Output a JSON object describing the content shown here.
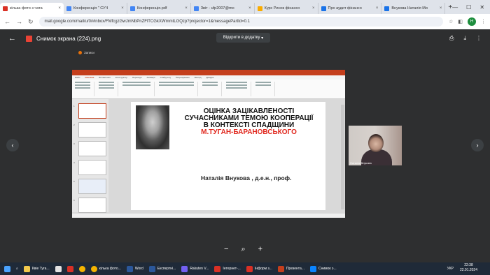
{
  "tabs": [
    {
      "title": "кілька фото з чата",
      "color": "#d93025",
      "active": true
    },
    {
      "title": "Конференція \" СУЧ",
      "color": "#4285f4"
    },
    {
      "title": "Конференція.pdf",
      "color": "#4285f4"
    },
    {
      "title": "Звіт - ufp2007@mo",
      "color": "#4285f4"
    },
    {
      "title": "Курс Ринок фінансо",
      "color": "#f9ab00"
    },
    {
      "title": "Про аудит фінансо",
      "color": "#1a73e8"
    },
    {
      "title": "Внукова Наталія Ми",
      "color": "#1a73e8"
    }
  ],
  "browser": {
    "url": "mail.google.com/mail/u/0/#inbox/FMfcgzGwJmNbPnZFlTCGkXWmmtLGQzp?projector=1&messagePartId=0.1",
    "avatar": "Н"
  },
  "viewer": {
    "filename": "Снимок экрана (224).png",
    "open_with": "Відкрити в додатку",
    "note": "Записи"
  },
  "slide": {
    "title_lines": [
      "ОЦІНКА ЗАЦІКАВЛЕНОСТІ",
      "СУЧАСНИКАМИ ТЕМОЮ КООПЕРАЦІЇ",
      "В КОНТЕКСТІ СПАДЩИНИ"
    ],
    "title_name": "М.ТУГАН-БАРАНОВСЬКОГО",
    "author": "Наталія Внукова , д.е.н., проф."
  },
  "ppt_menu": [
    "Файл",
    "Основне",
    "Вставлення",
    "Конструктор",
    "Переходи",
    "Анімація",
    "Слайд-шоу",
    "Рецензування",
    "Вигляд",
    "Довідка"
  ],
  "camera": {
    "name": "Наталія Внукова"
  },
  "taskbar": {
    "items": [
      "Квіе Туга...",
      "",
      "",
      "",
      "кілька фото...",
      "Word",
      "Експертні...",
      "Rakuten V...",
      "Інтернет-...",
      "Інформ з...",
      "Презента...",
      "Снимок э..."
    ],
    "lang": "УКР",
    "time": "22:38",
    "date": "22.01.2024"
  }
}
